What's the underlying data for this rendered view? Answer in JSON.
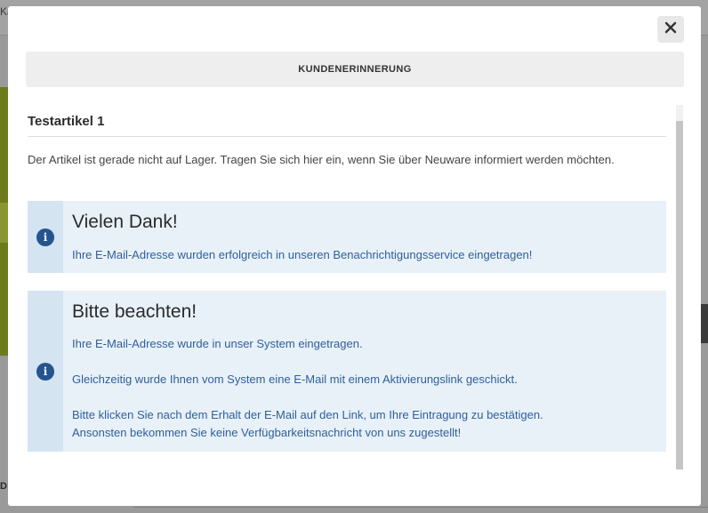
{
  "background": {
    "tab_text": "Ka",
    "bottom_letter": "D"
  },
  "modal": {
    "close_label": "✕",
    "header": "KUNDENERINNERUNG",
    "product_title": "Testartikel 1",
    "intro": "Der Artikel ist gerade nicht auf Lager. Tragen Sie sich hier ein, wenn Sie über Neuware informiert werden möchten.",
    "alerts": [
      {
        "icon": "info-icon",
        "heading": "Vielen Dank!",
        "lines": [
          "Ihre E-Mail-Adresse wurden erfolgreich in unseren Benachrichtigungsservice eingetragen!"
        ]
      },
      {
        "icon": "info-icon",
        "heading": "Bitte beachten!",
        "lines": [
          "Ihre E-Mail-Adresse wurde in unser System eingetragen.",
          "Gleichzeitig wurde Ihnen vom System eine E-Mail mit einem Aktivierungslink geschickt.",
          "Bitte klicken Sie nach dem Erhalt der E-Mail auf den Link, um Ihre Eintragung zu bestätigen.",
          "Ansonsten bekommen Sie keine Verfügbarkeitsnachricht von uns zugestellt!"
        ]
      }
    ]
  },
  "colors": {
    "alert_bg": "#e8f1f8",
    "alert_icon_col": "#d5e4f1",
    "icon_fill": "#25548e",
    "alert_text": "#2f5f9a"
  }
}
